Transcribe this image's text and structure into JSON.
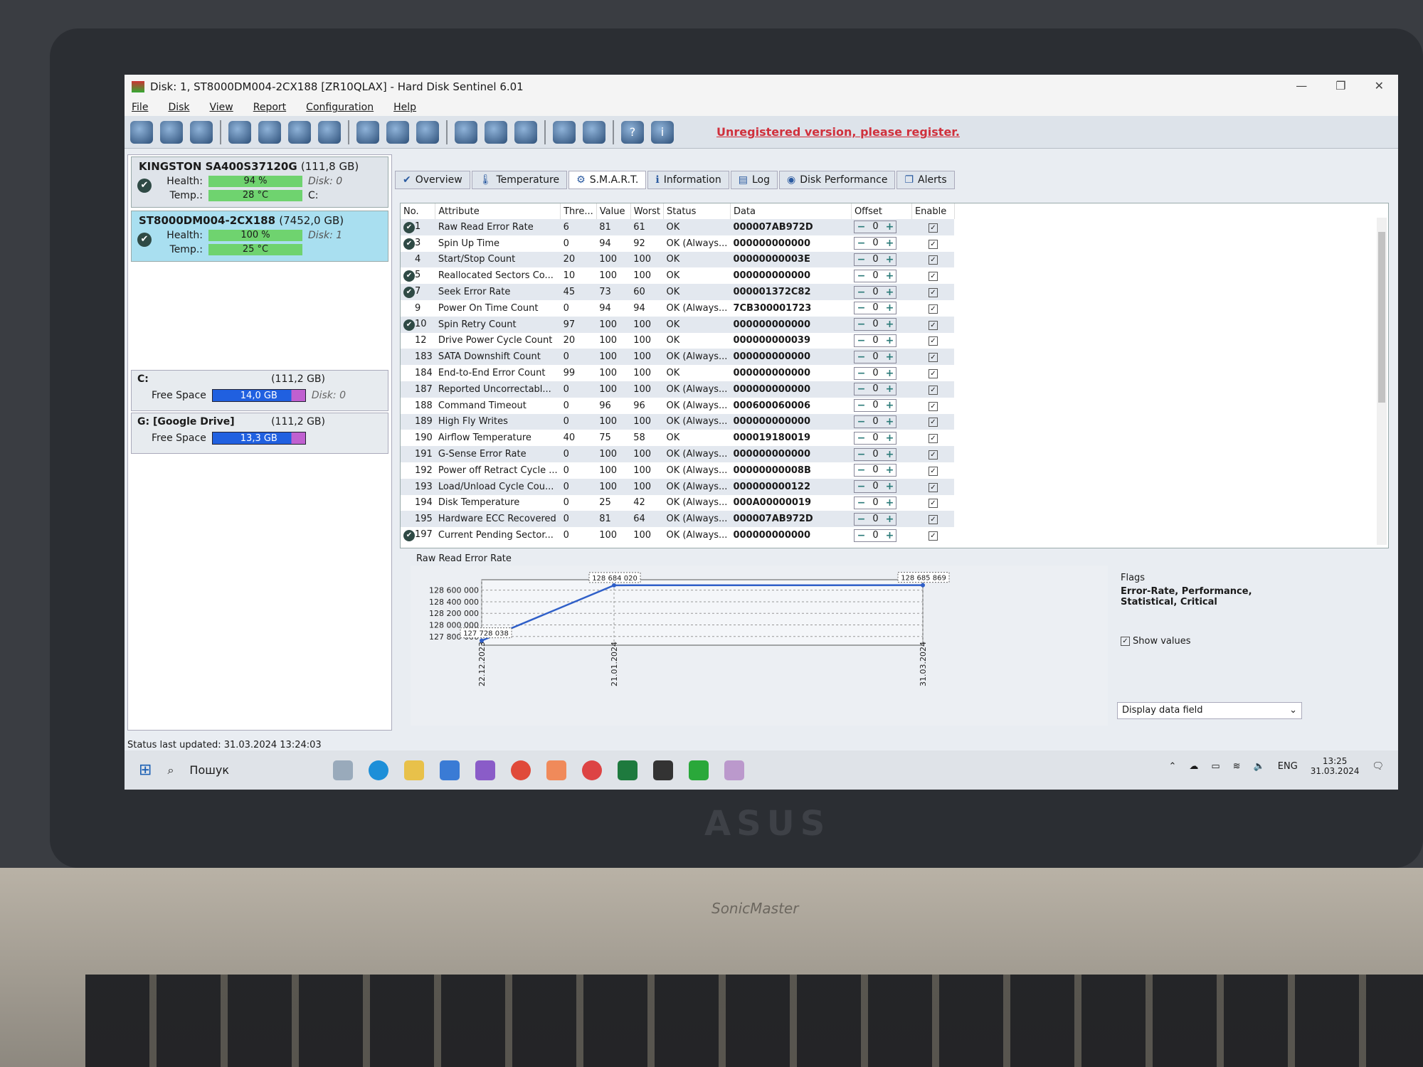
{
  "window": {
    "title": "Disk: 1, ST8000DM004-2CX188 [ZR10QLAX]  -  Hard Disk Sentinel 6.01",
    "controls": [
      "—",
      "❐",
      "✕"
    ]
  },
  "menu": [
    "File",
    "Disk",
    "View",
    "Report",
    "Configuration",
    "Help"
  ],
  "toolbar": {
    "icons": [
      "refresh-icon",
      "alert-icon",
      "disk-icon",
      "disk-dark-icon",
      "disk-info-icon",
      "disk-check-icon",
      "disk-search-icon",
      "globe-icon",
      "disks-icon",
      "drive-icon",
      "report-icon",
      "sync-icon",
      "network-icon",
      "laptop-icon",
      "sound-icon",
      "help-icon",
      "info-icon"
    ],
    "unregistered": "Unregistered version, please register."
  },
  "disks": [
    {
      "name": "KINGSTON SA400S37120G",
      "size": "(111,8 GB)",
      "health_label": "Health:",
      "health": "94 %",
      "health_pct": 94,
      "temp_label": "Temp.:",
      "temp": "28 °C",
      "disk": "Disk: 0",
      "drive": "C:"
    },
    {
      "name": "ST8000DM004-2CX188",
      "size": "(7452,0 GB)",
      "health_label": "Health:",
      "health": "100 %",
      "health_pct": 100,
      "temp_label": "Temp.:",
      "temp": "25 °C",
      "disk": "Disk: 1"
    }
  ],
  "partitions": [
    {
      "name": "C:",
      "size": "(111,2 GB)",
      "free_label": "Free Space",
      "free": "14,0 GB",
      "disk": "Disk: 0"
    },
    {
      "name": "G: [Google Drive]",
      "size": "(111,2 GB)",
      "free_label": "Free Space",
      "free": "13,3 GB"
    }
  ],
  "tabs": [
    {
      "label": "Overview",
      "icon": "✔"
    },
    {
      "label": "Temperature",
      "icon": "🌡"
    },
    {
      "label": "S.M.A.R.T.",
      "icon": "⚙",
      "active": true
    },
    {
      "label": "Information",
      "icon": "ℹ"
    },
    {
      "label": "Log",
      "icon": "▤"
    },
    {
      "label": "Disk Performance",
      "icon": "◉"
    },
    {
      "label": "Alerts",
      "icon": "❐"
    }
  ],
  "smart": {
    "columns": [
      "No.",
      "Attribute",
      "Thre...",
      "Value",
      "Worst",
      "Status",
      "Data",
      "Offset",
      "Enable"
    ],
    "rows": [
      {
        "no": "1",
        "attr": "Raw Read Error Rate",
        "thr": "6",
        "val": "81",
        "worst": "61",
        "status": "OK",
        "data": "000007AB972D",
        "offset": "0",
        "check": true
      },
      {
        "no": "3",
        "attr": "Spin Up Time",
        "thr": "0",
        "val": "94",
        "worst": "92",
        "status": "OK (Always...",
        "data": "000000000000",
        "offset": "0",
        "check": true
      },
      {
        "no": "4",
        "attr": "Start/Stop Count",
        "thr": "20",
        "val": "100",
        "worst": "100",
        "status": "OK",
        "data": "00000000003E",
        "offset": "0"
      },
      {
        "no": "5",
        "attr": "Reallocated Sectors Co...",
        "thr": "10",
        "val": "100",
        "worst": "100",
        "status": "OK",
        "data": "000000000000",
        "offset": "0",
        "check": true
      },
      {
        "no": "7",
        "attr": "Seek Error Rate",
        "thr": "45",
        "val": "73",
        "worst": "60",
        "status": "OK",
        "data": "000001372C82",
        "offset": "0",
        "check": true
      },
      {
        "no": "9",
        "attr": "Power On Time Count",
        "thr": "0",
        "val": "94",
        "worst": "94",
        "status": "OK (Always...",
        "data": "7CB300001723",
        "offset": "0"
      },
      {
        "no": "10",
        "attr": "Spin Retry Count",
        "thr": "97",
        "val": "100",
        "worst": "100",
        "status": "OK",
        "data": "000000000000",
        "offset": "0",
        "check": true
      },
      {
        "no": "12",
        "attr": "Drive Power Cycle Count",
        "thr": "20",
        "val": "100",
        "worst": "100",
        "status": "OK",
        "data": "000000000039",
        "offset": "0"
      },
      {
        "no": "183",
        "attr": "SATA Downshift Count",
        "thr": "0",
        "val": "100",
        "worst": "100",
        "status": "OK (Always...",
        "data": "000000000000",
        "offset": "0"
      },
      {
        "no": "184",
        "attr": "End-to-End Error Count",
        "thr": "99",
        "val": "100",
        "worst": "100",
        "status": "OK",
        "data": "000000000000",
        "offset": "0"
      },
      {
        "no": "187",
        "attr": "Reported Uncorrectabl...",
        "thr": "0",
        "val": "100",
        "worst": "100",
        "status": "OK (Always...",
        "data": "000000000000",
        "offset": "0"
      },
      {
        "no": "188",
        "attr": "Command Timeout",
        "thr": "0",
        "val": "96",
        "worst": "96",
        "status": "OK (Always...",
        "data": "000600060006",
        "offset": "0"
      },
      {
        "no": "189",
        "attr": "High Fly Writes",
        "thr": "0",
        "val": "100",
        "worst": "100",
        "status": "OK (Always...",
        "data": "000000000000",
        "offset": "0"
      },
      {
        "no": "190",
        "attr": "Airflow Temperature",
        "thr": "40",
        "val": "75",
        "worst": "58",
        "status": "OK",
        "data": "000019180019",
        "offset": "0"
      },
      {
        "no": "191",
        "attr": "G-Sense Error Rate",
        "thr": "0",
        "val": "100",
        "worst": "100",
        "status": "OK (Always...",
        "data": "000000000000",
        "offset": "0"
      },
      {
        "no": "192",
        "attr": "Power off Retract Cycle ...",
        "thr": "0",
        "val": "100",
        "worst": "100",
        "status": "OK (Always...",
        "data": "00000000008B",
        "offset": "0"
      },
      {
        "no": "193",
        "attr": "Load/Unload Cycle Cou...",
        "thr": "0",
        "val": "100",
        "worst": "100",
        "status": "OK (Always...",
        "data": "000000000122",
        "offset": "0"
      },
      {
        "no": "194",
        "attr": "Disk Temperature",
        "thr": "0",
        "val": "25",
        "worst": "42",
        "status": "OK (Always...",
        "data": "000A00000019",
        "offset": "0"
      },
      {
        "no": "195",
        "attr": "Hardware ECC Recovered",
        "thr": "0",
        "val": "81",
        "worst": "64",
        "status": "OK (Always...",
        "data": "000007AB972D",
        "offset": "0"
      },
      {
        "no": "197",
        "attr": "Current Pending Sector...",
        "thr": "0",
        "val": "100",
        "worst": "100",
        "status": "OK (Always...",
        "data": "000000000000",
        "offset": "0",
        "check": true
      }
    ]
  },
  "chart_data": {
    "type": "line",
    "title": "Raw Read Error Rate",
    "x": [
      "22.12.2023",
      "21.01.2024",
      "31.03.2024"
    ],
    "x_days": [
      0,
      30,
      100
    ],
    "values": [
      127728038,
      128684020,
      128685869
    ],
    "value_labels": [
      "127 728 038",
      "128 684 020",
      "128 685 869"
    ],
    "yticks": [
      127800000,
      128000000,
      128200000,
      128400000,
      128600000
    ],
    "ytick_labels": [
      "127 800 000",
      "128 000 000",
      "128 200 000",
      "128 400 000",
      "128 600 000"
    ],
    "ylim": [
      127650000,
      128780000
    ],
    "grid": true,
    "color": "#2f5fc8"
  },
  "side": {
    "flags_label": "Flags",
    "flags": "Error-Rate, Performance, Statistical, Critical",
    "show_values": "Show values",
    "show_values_checked": true,
    "dropdown": "Display data field"
  },
  "status": "Status last updated: 31.03.2024 13:24:03",
  "taskbar": {
    "search": "Пошук",
    "lang": "ENG",
    "time": "13:25",
    "date": "31.03.2024"
  },
  "laptop": {
    "brand": "ASUS",
    "label": "SonicMaster"
  }
}
